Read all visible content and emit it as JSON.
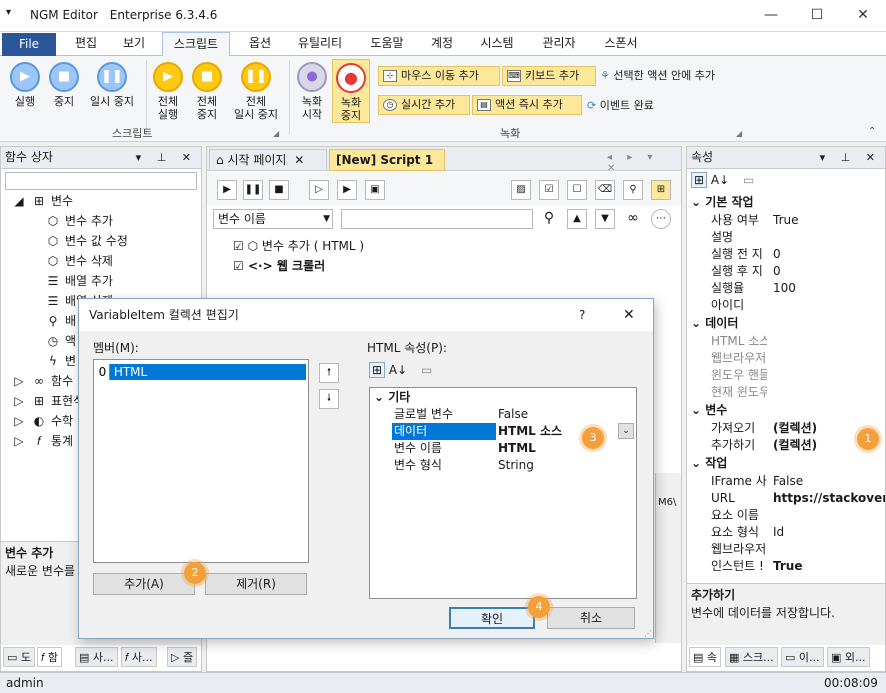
{
  "window": {
    "app_name": "NGM Editor",
    "edition": "Enterprise 6.3.4.6",
    "minimize": "—",
    "maximize": "☐",
    "close": "✕"
  },
  "menu": {
    "file": "File",
    "items": [
      "편집",
      "보기",
      "스크립트",
      "옵션",
      "유틸리티",
      "도움말",
      "계정",
      "시스템",
      "관리자",
      "스폰서"
    ],
    "active": "스크립트"
  },
  "ribbon": {
    "script_group": {
      "label": "스크립트",
      "buttons": [
        {
          "label": "실행"
        },
        {
          "label": "중지"
        },
        {
          "label": "일시 중지"
        },
        {
          "label": "전체 실행",
          "line1": "전체",
          "line2": "실행"
        },
        {
          "label": "전체 중지",
          "line1": "전체",
          "line2": "중지"
        },
        {
          "label": "전체 일시 중지",
          "line1": "전체",
          "line2": "일시 중지"
        }
      ]
    },
    "record_group": {
      "label": "녹화",
      "record_start": {
        "line1": "녹화",
        "line2": "시작"
      },
      "record_stop": {
        "line1": "녹화",
        "line2": "중지"
      },
      "actions": [
        "마우스 이동 추가",
        "키보드 추가",
        "실시간 추가",
        "액션 즉시 추가"
      ],
      "insert_into_action": "선택한 액션 안에 추가",
      "event_complete": "이벤트 완료"
    }
  },
  "left_panel": {
    "title": "함수 상자",
    "tree": [
      {
        "label": "변수",
        "level": 0,
        "icon": "variable-group-icon"
      },
      {
        "label": "변수 추가",
        "level": 1,
        "icon": "cube-icon"
      },
      {
        "label": "변수 값 수정",
        "level": 1,
        "icon": "cube-icon"
      },
      {
        "label": "변수 삭제",
        "level": 1,
        "icon": "cube-icon"
      },
      {
        "label": "배열 추가",
        "level": 1,
        "icon": "database-icon"
      },
      {
        "label": "배열 삭제",
        "level": 1,
        "icon": "database-icon"
      },
      {
        "label": "배",
        "level": 1,
        "icon": "search-icon"
      },
      {
        "label": "액",
        "level": 1,
        "icon": "clock-icon"
      },
      {
        "label": "변",
        "level": 1,
        "icon": "lightning-icon"
      },
      {
        "label": "함수",
        "level": 0,
        "icon": "function-icon"
      },
      {
        "label": "표현식",
        "level": 0,
        "icon": "expression-icon"
      },
      {
        "label": "수학",
        "level": 0,
        "icon": "math-icon"
      },
      {
        "label": "통계",
        "level": 0,
        "icon": "fx-icon"
      }
    ],
    "desc_title": "변수 추가",
    "desc_text": "새로운 변수를",
    "bottom_tabs": [
      "도",
      "함",
      "사...",
      "사...",
      "즐"
    ]
  },
  "editor": {
    "tabs": [
      {
        "label": "시작 페이지",
        "active": false
      },
      {
        "label": "[New] Script 1",
        "active": true
      }
    ],
    "search": {
      "field": "변수 이름",
      "placeholder": ""
    },
    "items": [
      {
        "label": "변수 추가 ( HTML )",
        "checked": true
      },
      {
        "label": "웹 크롤러",
        "checked": true,
        "bold": true
      }
    ],
    "partial_text": "M6\\"
  },
  "right_panel": {
    "title": "속성",
    "categories": [
      {
        "name": "기본 작업",
        "rows": [
          {
            "k": "사용 여부",
            "v": "True"
          },
          {
            "k": "설명",
            "v": ""
          },
          {
            "k": "실행 전 지",
            "v": "0"
          },
          {
            "k": "실행 후 지",
            "v": "0"
          },
          {
            "k": "실행율",
            "v": "100"
          },
          {
            "k": "아이디",
            "v": ""
          }
        ]
      },
      {
        "name": "데이터",
        "rows": [
          {
            "k": "HTML 소스",
            "v": "",
            "muted": true
          },
          {
            "k": "웹브라우저",
            "v": "",
            "muted": true
          },
          {
            "k": "윈도우 핸들",
            "v": "",
            "muted": true
          },
          {
            "k": "현재 윈도우",
            "v": "",
            "muted": true
          }
        ]
      },
      {
        "name": "변수",
        "rows": [
          {
            "k": "가져오기",
            "v": "(컬렉션)",
            "bold": true
          },
          {
            "k": "추가하기",
            "v": "(컬렉션)",
            "bold": true
          }
        ]
      },
      {
        "name": "작업",
        "rows": [
          {
            "k": "IFrame 사",
            "v": "False"
          },
          {
            "k": "URL",
            "v": "https://stackover",
            "bold": true
          },
          {
            "k": "요소 이름",
            "v": ""
          },
          {
            "k": "요소 형식",
            "v": "Id"
          },
          {
            "k": "웹브라우저",
            "v": ""
          },
          {
            "k": "인스턴트 !",
            "v": "True",
            "bold": true
          }
        ]
      }
    ],
    "desc_title": "추가하기",
    "desc_text": "변수에 데이터를 저장합니다.",
    "bottom_tabs": [
      "속",
      "스크...",
      "이...",
      "외..."
    ]
  },
  "dialog": {
    "title": "VariableItem 컬렉션 편집기",
    "help": "?",
    "members_label": "멤버(M):",
    "members": [
      {
        "index": "0",
        "name": "HTML"
      }
    ],
    "props_label": "HTML 속성(P):",
    "category": "기타",
    "props": [
      {
        "k": "글로벌 변수",
        "v": "False"
      },
      {
        "k": "데이터",
        "v": "HTML 소스",
        "selected": true
      },
      {
        "k": "변수 이름",
        "v": "HTML",
        "bold": true
      },
      {
        "k": "변수 형식",
        "v": "String"
      }
    ],
    "add": "추가(A)",
    "remove": "제거(R)",
    "ok": "확인",
    "cancel": "취소"
  },
  "badges": [
    "1",
    "2",
    "3",
    "4"
  ],
  "status": {
    "user": "admin",
    "time": "00:08:09"
  }
}
